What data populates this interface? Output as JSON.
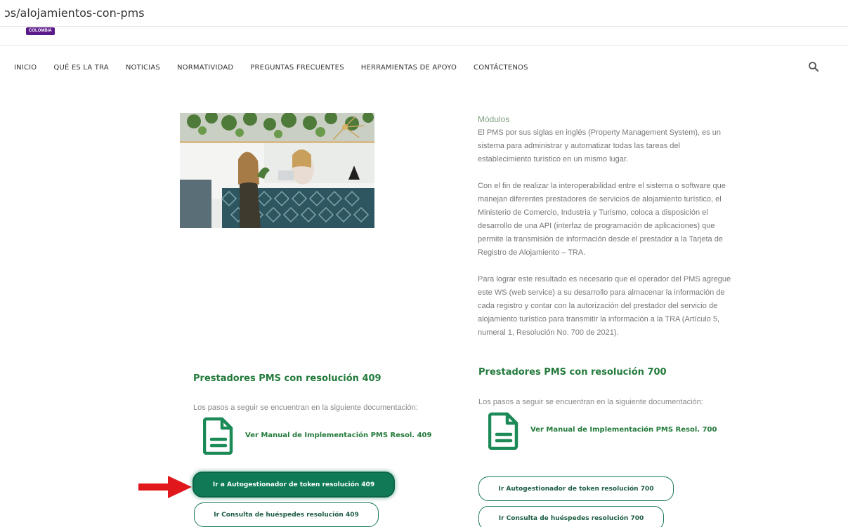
{
  "browser": {
    "url": "ɔs/alojamientos-con-pms"
  },
  "logo": {
    "badge_text": "COLOMBIA"
  },
  "nav": {
    "items": [
      "INICIO",
      "QUÉ ES LA TRA",
      "NOTICIAS",
      "NORMATIVIDAD",
      "PREGUNTAS FRECUENTES",
      "HERRAMIENTAS DE APOYO",
      "CONTÁCTENOS"
    ],
    "search_icon": "search-icon"
  },
  "modulos": {
    "title": "Módulos",
    "paragraphs": [
      "El PMS por sus siglas en inglés (Property Management System), es un sistema para administrar y automatizar todas las tareas del establecimiento turístico en un mismo lugar.",
      "Con el fin de realizar la interoperabilidad entre el sistema o software que manejan diferentes prestadores de servicios de alojamiento turístico, el Ministerio de Comercio, Industria y Turismo, coloca a disposición el desarrollo de una API (interfaz de programación de aplicaciones) que permite la transmisión de información desde el prestador a la Tarjeta de Registro de Alojamiento – TRA.",
      "Para lograr este resultado es necesario que el operador del PMS agregue este WS (web service) a su desarrollo para almacenar la información de cada registro y contar con la autorización del prestador del servicio de alojamiento turístico para transmitir la información a la TRA (Artículo 5, numeral 1, Resolución No. 700 de 2021)."
    ]
  },
  "res409": {
    "title": "Prestadores PMS con resolución 409",
    "text": "Los pasos a seguir se encuentran en la siguiente documentación:",
    "manual_link": "Ver Manual de Implementación PMS Resol. 409",
    "token_button": "Ir a Autogestionador de token resolución 409",
    "consulta_button": "Ir Consulta de huéspedes resolución 409"
  },
  "res700": {
    "title": "Prestadores PMS con resolución 700",
    "text": "Los pasos a seguir se encuentran en la siguiente documentación:",
    "manual_link": "Ver Manual de Implementación PMS Resol. 700",
    "token_button": "Ir Autogestionador de token resolución 700",
    "consulta_button": "Ir Consulta de huéspedes resolución 700"
  },
  "colors": {
    "brand_green": "#237a3b",
    "button_green": "#0f7a55",
    "arrow_red": "#e0181b",
    "badge_purple": "#5b1a8a"
  }
}
